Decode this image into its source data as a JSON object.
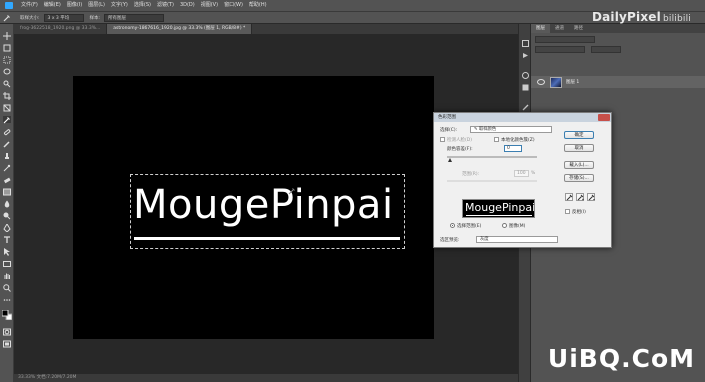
{
  "app": {
    "menus": [
      "文件(F)",
      "编辑(E)",
      "图像(I)",
      "图层(L)",
      "文字(Y)",
      "选择(S)",
      "滤镜(T)",
      "3D(D)",
      "视图(V)",
      "窗口(W)",
      "帮助(H)"
    ],
    "brand": "DailyPixel",
    "brand_suffix": "bilibili",
    "accent": "#31a8ff"
  },
  "options_bar": {
    "sample_size_label": "取样大小:",
    "sample_size_value": "3 x 3 平均",
    "sample_label": "样本:",
    "sample_value": "所有图层"
  },
  "tabs": [
    {
      "label": "frog-3622518_1920.png @ 33.3%...",
      "active": false
    },
    {
      "label": "astronomy-1867616_1920.jpg @ 33.3% (图层 1, RGB/8#) *",
      "active": true
    }
  ],
  "canvas": {
    "text": "MougePinpai",
    "status": "33.33%    文档:7.20M/7.20M"
  },
  "layers_panel": {
    "tabs": [
      "图层",
      "通道",
      "路径"
    ],
    "layer_name": "图层 1"
  },
  "dialog": {
    "title": "色彩范围",
    "select_label": "选择(C):",
    "select_value": "取样颜色",
    "detect_faces_label": "检测人脸(D)",
    "localized_label": "本地化颜色簇(Z)",
    "fuzziness_label": "颜色容差(F):",
    "fuzziness_value": "0",
    "range_label": "范围(R):",
    "range_value": "100",
    "range_unit": "%",
    "preview_text": "MougePinpai",
    "radio_selection": "选择范围(E)",
    "radio_image": "图像(M)",
    "preview_label": "选区预览:",
    "preview_value": "灰度",
    "ok": "确定",
    "cancel": "取消",
    "load": "载入(L)...",
    "save": "存储(S)...",
    "invert": "反相(I)"
  },
  "watermark": "UiBQ.CoM"
}
